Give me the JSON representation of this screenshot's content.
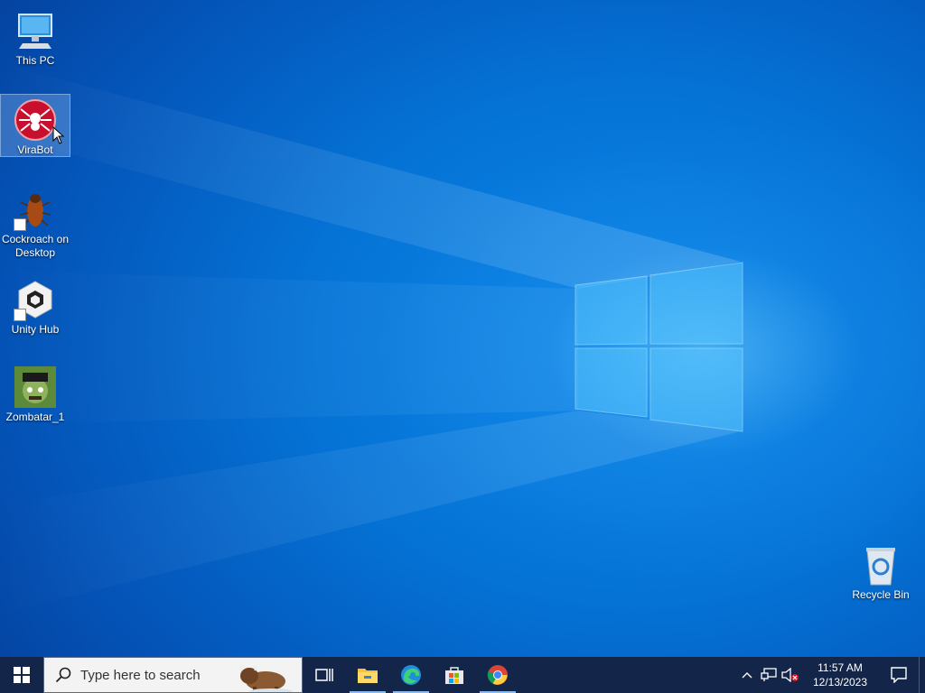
{
  "desktop": {
    "icons": [
      {
        "label": "This PC"
      },
      {
        "label": "ViraBot"
      },
      {
        "label": "Cockroach on Desktop"
      },
      {
        "label": "Unity Hub"
      },
      {
        "label": "Zombatar_1"
      },
      {
        "label": "Recycle Bin"
      }
    ]
  },
  "taskbar": {
    "search": {
      "placeholder": "Type here to search"
    },
    "apps": [
      "start",
      "task-view",
      "file-explorer",
      "edge",
      "store",
      "chrome"
    ],
    "clock": {
      "time": "11:57 AM",
      "date": "12/13/2023"
    }
  },
  "colors": {
    "taskbar_bg": "#14254a",
    "desktop_accent": "#0a86e8"
  }
}
